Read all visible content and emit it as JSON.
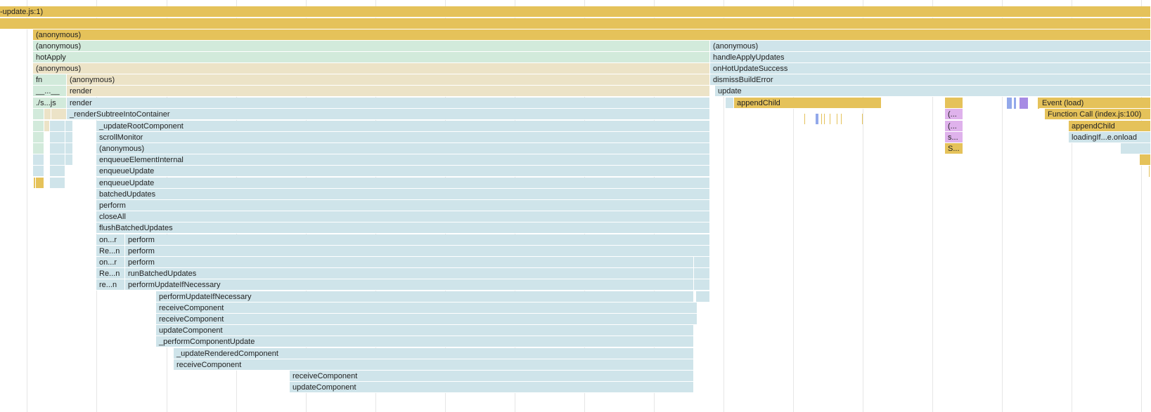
{
  "frames": {
    "r0_main": "-update.js:1)",
    "r1_main": "",
    "r2_anon": "(anonymous)",
    "r3_anon_left": "(anonymous)",
    "r3_anon_right": "(anonymous)",
    "r4_hotApply": "hotApply",
    "r4_handleApplyUpdates": "handleApplyUpdates",
    "r5_anon_left": "(anonymous)",
    "r5_onHotUpdateSuccess": "onHotUpdateSuccess",
    "r6_fn": "fn",
    "r6_anon": "(anonymous)",
    "r6_dismissBuildError": "dismissBuildError",
    "r7_short": "__...__",
    "r7_render": "render",
    "r7_update": "update",
    "r8_short": "./s...js",
    "r8_render": "render",
    "r8_appendChild": "appendChild",
    "r8_event_load": "Event (load)",
    "r9_renderSubtree": "_renderSubtreeIntoContainer",
    "r9_paren": "(...",
    "r9_function_call": "Function Call (index.js:100)",
    "r10_updateRoot": "_updateRootComponent",
    "r10_paren": "(...",
    "r10_appendChild": "appendChild",
    "r11_scrollMonitor": "scrollMonitor",
    "r11_s": "s...",
    "r11_loadingIf": "loadingIf...e.onload",
    "r12_anon": "(anonymous)",
    "r12_S": "S...",
    "r13_enqueueElementInternal": "enqueueElementInternal",
    "r14_enqueueUpdate": "enqueueUpdate",
    "r15_enqueueUpdate": "enqueueUpdate",
    "r16_batchedUpdates": "batchedUpdates",
    "r17_perform": "perform",
    "r18_closeAll": "closeAll",
    "r19_flushBatchedUpdates": "flushBatchedUpdates",
    "r20_onr": "on...r",
    "r20_perform": "perform",
    "r21_Ren": "Re...n",
    "r21_perform": "perform",
    "r22_onr": "on...r",
    "r22_perform": "perform",
    "r23_Ren": "Re...n",
    "r23_runBatchedUpdates": "runBatchedUpdates",
    "r24_ren": "re...n",
    "r24_performUpdateIfNecessary": "performUpdateIfNecessary",
    "r25_performUpdateIfNecessary": "performUpdateIfNecessary",
    "r26_receiveComponent": "receiveComponent",
    "r27_receiveComponent": "receiveComponent",
    "r28_updateComponent": "updateComponent",
    "r29_performComponentUpdate": "_performComponentUpdate",
    "r30_updateRenderedComponent": "_updateRenderedComponent",
    "r31_receiveComponent": "receiveComponent",
    "r32_receiveComponent": "receiveComponent",
    "r33_updateComponent": "updateComponent"
  },
  "colors": {
    "scripting_yellow": "#e5c25a",
    "green": "#d2eadb",
    "tan": "#ece3c7",
    "light_blue": "#cfe4ea",
    "pink": "#dfb2ec",
    "blue": "#92a8ea",
    "purple": "#a78be4",
    "grid": "#e6e6e6"
  }
}
